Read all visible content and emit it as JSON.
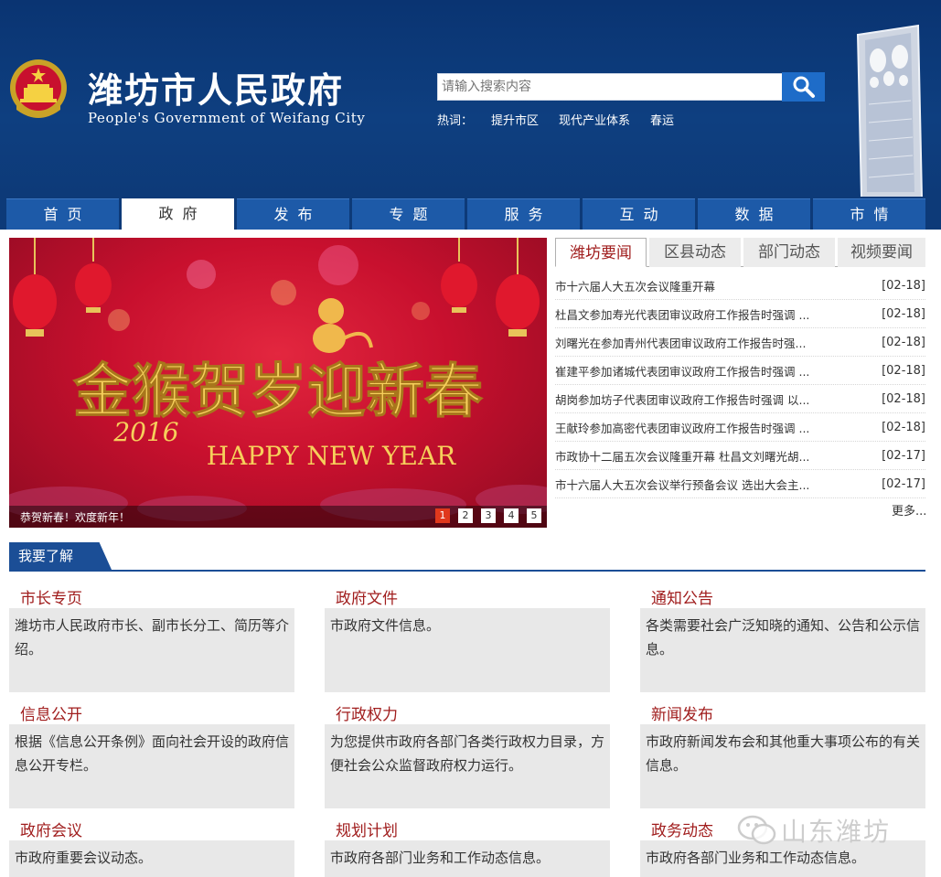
{
  "header": {
    "title": "潍坊市人民政府",
    "subtitle": "People's Government of Weifang City",
    "search_placeholder": "请输入搜索内容",
    "hotwords_label": "热词：",
    "hotwords": [
      "提升市区",
      "现代产业体系",
      "春运"
    ]
  },
  "nav": {
    "items": [
      "首页",
      "政府",
      "发布",
      "专题",
      "服务",
      "互动",
      "数据",
      "市情"
    ],
    "active": "政府"
  },
  "banner": {
    "headline": "金猴贺岁迎新春",
    "year": "2016",
    "english": "HAPPY NEW YEAR",
    "caption": "恭贺新春！欢度新年！",
    "slides": [
      "1",
      "2",
      "3",
      "4",
      "5"
    ],
    "active_slide": "1"
  },
  "news": {
    "tabs": [
      "潍坊要闻",
      "区县动态",
      "部门动态",
      "视频要闻"
    ],
    "active_tab": "潍坊要闻",
    "items": [
      {
        "title": "市十六届人大五次会议隆重开幕",
        "date": "[02-18]"
      },
      {
        "title": "杜昌文参加寿光代表团审议政府工作报告时强调 ...",
        "date": "[02-18]"
      },
      {
        "title": "刘曙光在参加青州代表团审议政府工作报告时强...",
        "date": "[02-18]"
      },
      {
        "title": "崔建平参加诸城代表团审议政府工作报告时强调 ...",
        "date": "[02-18]"
      },
      {
        "title": "胡岗参加坊子代表团审议政府工作报告时强调 以...",
        "date": "[02-18]"
      },
      {
        "title": "王献玲参加高密代表团审议政府工作报告时强调 ...",
        "date": "[02-18]"
      },
      {
        "title": "市政协十二届五次会议隆重开幕 杜昌文刘曙光胡...",
        "date": "[02-17]"
      },
      {
        "title": "市十六届人大五次会议举行预备会议 选出大会主...",
        "date": "[02-17]"
      }
    ],
    "more": "更多..."
  },
  "section": {
    "title": "我要了解",
    "cards": [
      {
        "title": "市长专页",
        "desc": "潍坊市人民政府市长、副市长分工、简历等介绍。"
      },
      {
        "title": "政府文件",
        "desc": "市政府文件信息。"
      },
      {
        "title": "通知公告",
        "desc": "各类需要社会广泛知晓的通知、公告和公示信息。"
      },
      {
        "title": "信息公开",
        "desc": "根据《信息公开条例》面向社会开设的政府信息公开专栏。"
      },
      {
        "title": "行政权力",
        "desc": "为您提供市政府各部门各类行政权力目录，方便社会公众监督政府权力运行。"
      },
      {
        "title": "新闻发布",
        "desc": "市政府新闻发布会和其他重大事项公布的有关信息。"
      },
      {
        "title": "政府会议",
        "desc": "市政府重要会议动态。"
      },
      {
        "title": "规划计划",
        "desc": "市政府各部门业务和工作动态信息。"
      },
      {
        "title": "政务动态",
        "desc": "市政府各部门业务和工作动态信息。"
      }
    ]
  },
  "watermark": "山东潍坊",
  "colors": {
    "header_bg": "#0d3a78",
    "nav_item": "#1d5aa8",
    "accent_red": "#a01d1d",
    "section_blue": "#1b4e96",
    "search_button": "#1e6cc8"
  }
}
